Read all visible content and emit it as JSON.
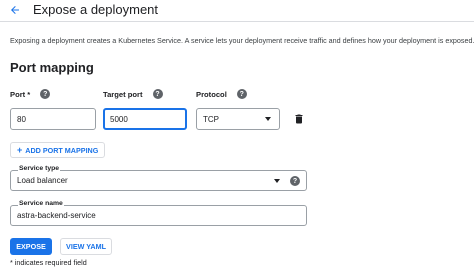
{
  "header": {
    "title": "Expose a deployment"
  },
  "description": "Exposing a deployment creates a Kubernetes Service. A service lets your deployment receive traffic and defines how your deployment is exposed.",
  "port_mapping": {
    "title": "Port mapping",
    "columns": {
      "port": "Port *",
      "target_port": "Target port",
      "protocol": "Protocol"
    },
    "row": {
      "port": "80",
      "target_port": "5000",
      "protocol": "TCP"
    },
    "add_button": "ADD PORT MAPPING"
  },
  "service_type": {
    "label": "Service type",
    "value": "Load balancer"
  },
  "service_name": {
    "label": "Service name",
    "value": "astra-backend-service"
  },
  "actions": {
    "expose": "EXPOSE",
    "view_yaml": "VIEW YAML"
  },
  "footnote": "* indicates required field",
  "colors": {
    "accent": "#1a73e8",
    "icon": "#5f6368",
    "border": "#9aa0a6"
  },
  "icons": {
    "back": "arrow-back-icon",
    "help": "help-circle-icon",
    "delete": "trash-icon",
    "add": "plus-icon",
    "dropdown": "caret-down-icon"
  }
}
